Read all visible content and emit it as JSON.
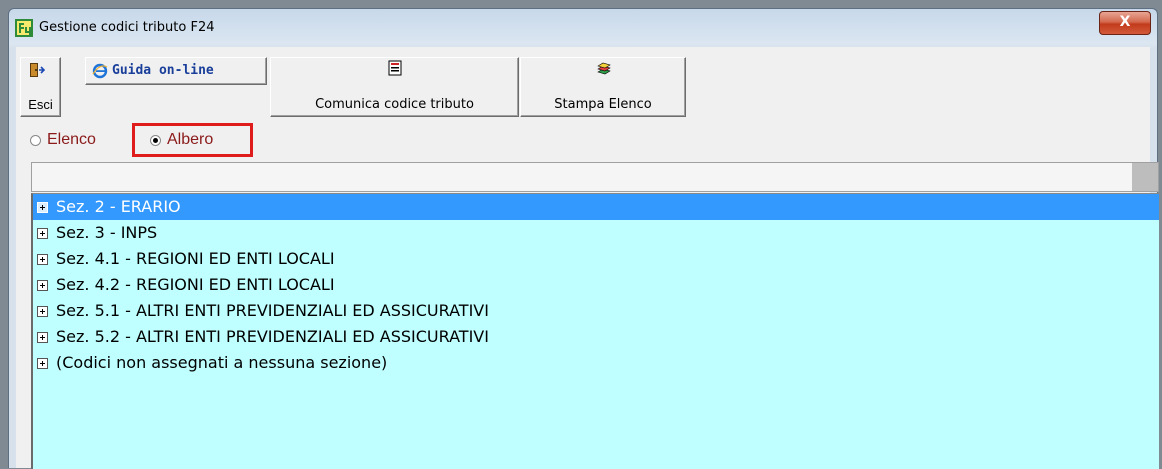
{
  "window": {
    "title": "Gestione codici tributo F24",
    "close_glyph": "X",
    "app_icon": "f24-app-icon"
  },
  "toolbar": {
    "esci_label": "Esci",
    "esci_icon": "exit-door-icon",
    "guida_label": "Guida on-line",
    "guida_icon": "internet-explorer-icon",
    "comunica_label": "Comunica codice tributo",
    "comunica_icon": "report-icon",
    "stampa_label": "Stampa Elenco",
    "stampa_icon": "printer-stack-icon"
  },
  "view_mode": {
    "options": [
      {
        "label": "Elenco",
        "checked": false
      },
      {
        "label": "Albero",
        "checked": true
      }
    ],
    "highlight_color": "#e01b1b"
  },
  "tree": {
    "background": "#bfffff",
    "selected_color": "#3399ff",
    "items": [
      {
        "label": "Sez. 2 - ERARIO",
        "selected": true
      },
      {
        "label": "Sez. 3 - INPS",
        "selected": false
      },
      {
        "label": "Sez. 4.1 - REGIONI ED ENTI LOCALI",
        "selected": false
      },
      {
        "label": "Sez. 4.2 - REGIONI ED ENTI LOCALI",
        "selected": false
      },
      {
        "label": "Sez. 5.1 - ALTRI ENTI PREVIDENZIALI ED ASSICURATIVI",
        "selected": false
      },
      {
        "label": "Sez. 5.2 - ALTRI ENTI PREVIDENZIALI ED ASSICURATIVI",
        "selected": false
      },
      {
        "label": "(Codici non assegnati a nessuna sezione)",
        "selected": false
      }
    ]
  }
}
